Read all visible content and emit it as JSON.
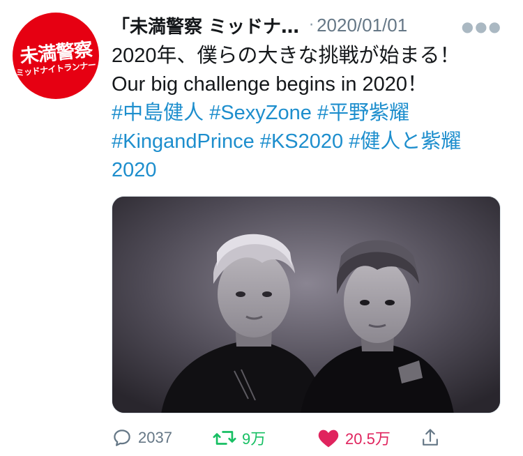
{
  "account": {
    "display_name": "「未満警察 ミッドナ…",
    "avatar_logo_main": "未満警察",
    "avatar_logo_sub": "ミッドナイトランナー",
    "brand_color": "#e60012"
  },
  "tweet": {
    "separator": "·",
    "timestamp": "2020/01/01",
    "more_label": "●●●",
    "text_line1": "2020年、僕らの大きな挑戦が始まる！",
    "text_line2": "Our big challenge begins in 2020！",
    "hashtags": {
      "h1": "#中島健人",
      "h2": "#SexyZone",
      "h3": "#平野紫耀",
      "h4": "#KingandPrince",
      "h5": "#KS2020",
      "h6": "#健人と紫耀",
      "h6_cont": "2020"
    },
    "hashtag_color": "#1d8ecd"
  },
  "stats": {
    "replies": "2037",
    "retweets": "9万",
    "likes": "20.5万",
    "retweet_color": "#17bf63",
    "like_color": "#e0245e"
  },
  "icons": [
    "reply-icon",
    "retweet-icon",
    "heart-icon",
    "share-icon",
    "more-icon"
  ]
}
